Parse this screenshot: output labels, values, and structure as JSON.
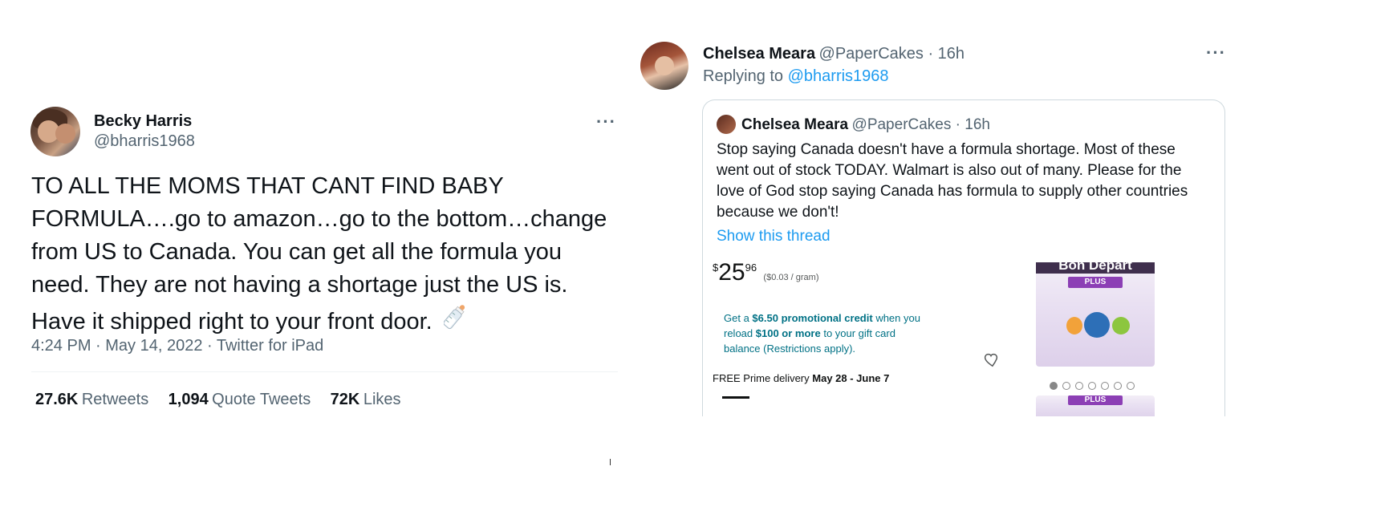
{
  "left_tweet": {
    "author_name": "Becky Harris",
    "author_handle": "@bharris1968",
    "more_icon": "more-horizontal-icon",
    "text_lines": [
      "TO ALL THE MOMS THAT CANT FIND BABY",
      "FORMULA….go to amazon…go to the bottom…change",
      "from US to Canada. You can get all the formula you",
      "need. They are not having a shortage just the US is.",
      "Have it shipped right to your front door."
    ],
    "emoji_icon": "baby-bottle-icon",
    "timestamp": "4:24 PM · May 14, 2022 · Twitter for iPad",
    "stats": {
      "retweets_count": "27.6K",
      "retweets_label": "Retweets",
      "quotes_count": "1,094",
      "quotes_label": "Quote Tweets",
      "likes_count": "72K",
      "likes_label": "Likes"
    }
  },
  "right_tweet": {
    "author_name": "Chelsea Meara",
    "author_handle_time": "@PaperCakes · 16h",
    "replying_prefix": "Replying to",
    "replying_to": "@bharris1968",
    "more_icon": "more-horizontal-icon",
    "quoted": {
      "author_name": "Chelsea Meara",
      "author_handle_time": "@PaperCakes · 16h",
      "text_lines": [
        "Stop saying Canada doesn't have a formula shortage. Most of these",
        "went out of stock TODAY. Walmart is also out of many. Please for the",
        "love of God stop saying Canada has formula to supply other countries",
        "because we don't!"
      ],
      "show_thread": "Show this thread",
      "embedded_screenshot": {
        "price_symbol": "$",
        "price_whole": "25",
        "price_fraction": "96",
        "unit_price": "($0.03 / gram)",
        "promo_prefix": "Get a",
        "promo_bold1": "$6.50 promotional credit",
        "promo_mid": "when you reload",
        "promo_bold2": "$100 or more",
        "promo_suffix": "to your gift card balance (Restrictions apply).",
        "ship_prefix": "FREE Prime delivery",
        "ship_dates": "May 28 - June 7",
        "product_brand": "Bon Depart",
        "product_tag": "PLUS",
        "heart_icon": "heart-outline-icon",
        "carousel_dots": 7
      }
    }
  }
}
